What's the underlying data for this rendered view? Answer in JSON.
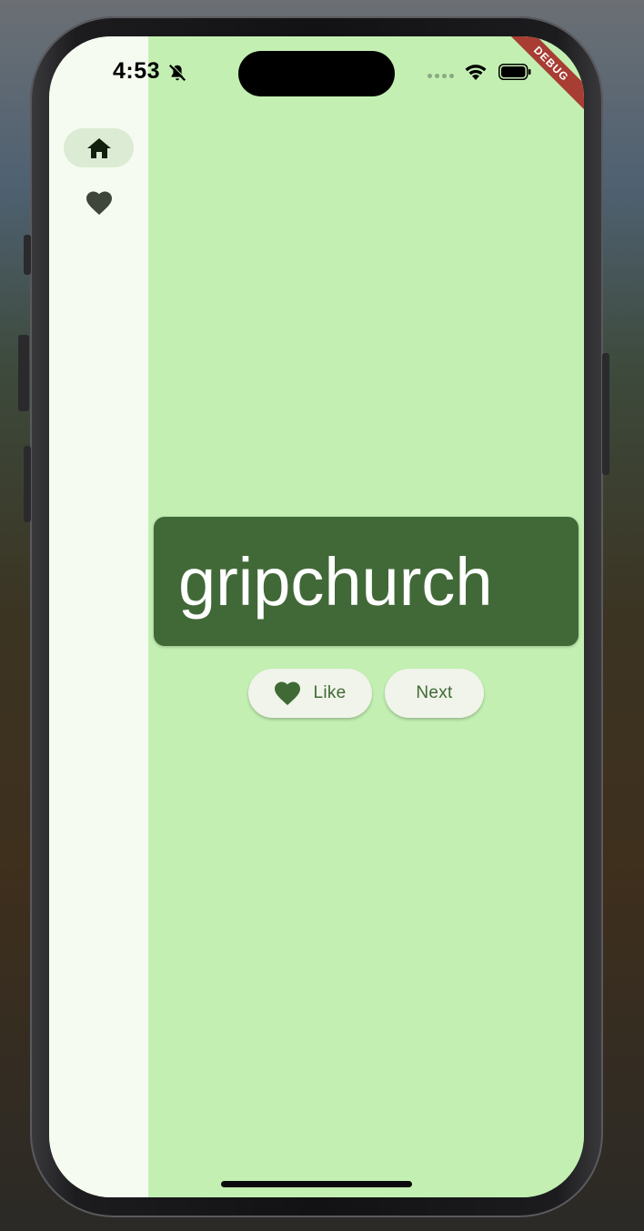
{
  "status_bar": {
    "time": "4:53"
  },
  "debug_banner": "DEBUG",
  "nav_rail": {
    "items": [
      {
        "icon": "home-icon",
        "selected": true
      },
      {
        "icon": "heart-icon",
        "selected": false
      }
    ]
  },
  "word_card": {
    "word": "gripchurch"
  },
  "actions": {
    "like_label": "Like",
    "next_label": "Next"
  },
  "colors": {
    "content_background": "#c3f0b2",
    "rail_background": "#f6fbf1",
    "card_background": "#416937",
    "button_background": "#f1f4ea",
    "accent": "#3f6a35",
    "debug_banner": "#a83d33"
  }
}
